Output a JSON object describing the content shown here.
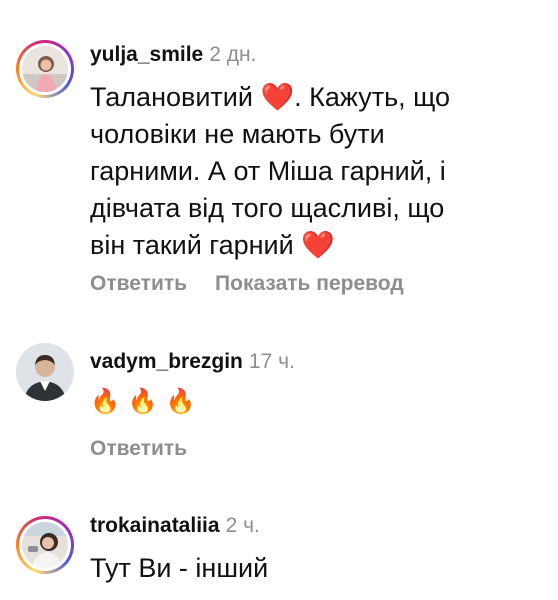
{
  "comments": [
    {
      "username": "yulja_smile",
      "time": "2 дн.",
      "text_lines": [
        "Талановитий",
        ". Кажуть, що",
        "чоловіки не мають бути",
        "гарними. А от Міша гарний, і",
        "дівчата від того щасливі, що",
        "він такий гарний"
      ],
      "heart": "❤️",
      "reply_label": "Ответить",
      "translate_label": "Показать перевод",
      "avatar_icon": "profile-photo-woman",
      "story_ring": true
    },
    {
      "username": "vadym_brezgin",
      "time": "17 ч.",
      "text": "🔥🔥🔥",
      "reply_label": "Ответить",
      "avatar_icon": "profile-photo-man",
      "story_ring": false
    },
    {
      "username": "trokainataliia",
      "time": "2 ч.",
      "text": "Тут Ви - інший",
      "avatar_icon": "profile-photo-woman",
      "story_ring": true
    }
  ],
  "colors": {
    "text": "#111111",
    "muted": "#8e8e8e",
    "heart": "#ed1c3a",
    "ring_start": "#feda75",
    "ring_end": "#962fbf"
  }
}
